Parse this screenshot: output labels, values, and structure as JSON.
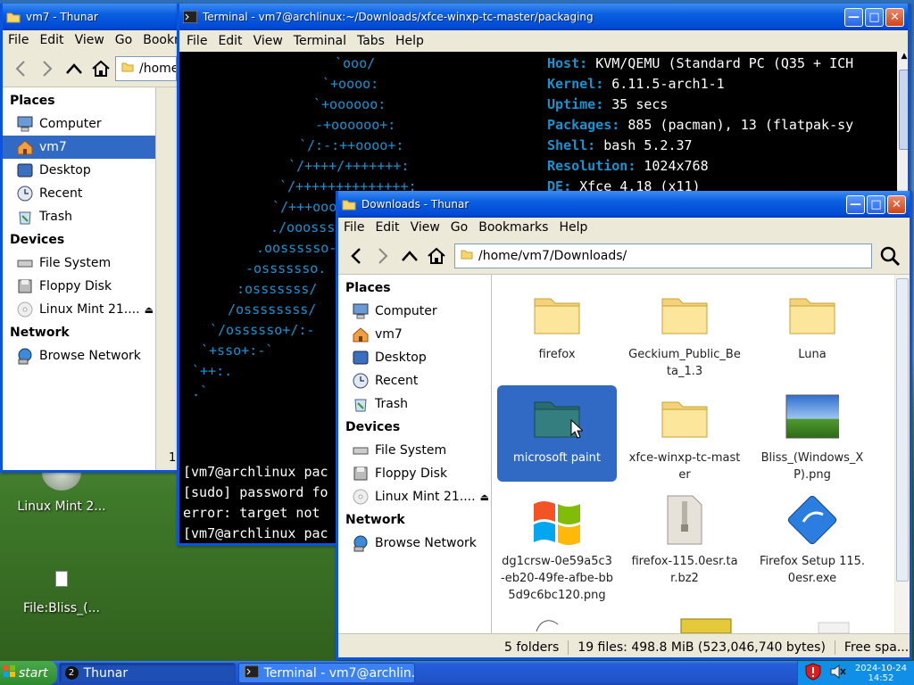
{
  "desktop": {
    "icons": [
      {
        "label": "Linux Mint 2..."
      },
      {
        "label": "File:Bliss_(..."
      }
    ]
  },
  "thunar_back": {
    "title": "vm7 - Thunar",
    "menu": [
      "File",
      "Edit",
      "View",
      "Go",
      "Bookm"
    ],
    "address": "/home",
    "places_header": "Places",
    "places": [
      "Computer",
      "vm7",
      "Desktop",
      "Recent",
      "Trash"
    ],
    "devices_header": "Devices",
    "devices": [
      "File System",
      "Floppy Disk",
      "Linux Mint 21...."
    ],
    "network_header": "Network",
    "network": [
      "Browse Network"
    ],
    "status_frag": "1"
  },
  "terminal": {
    "title": "Terminal - vm7@archlinux:~/Downloads/xfce-winxp-tc-master/packaging",
    "menu": [
      "File",
      "Edit",
      "View",
      "Terminal",
      "Tabs",
      "Help"
    ],
    "logo": [
      "`ooo/",
      "`+oooo:",
      "`+oooooo:",
      "-+oooooo+:",
      "`/:-:++oooo+:",
      "`/++++/+++++++:",
      "`/++++++++++++++:",
      "`/+++ooo",
      "./ooosss",
      ".oossssso-",
      "-osssssso.",
      ":osssssss/",
      "/ossssssss/",
      "`/ossssso+/:-",
      "`+sso+:-`",
      "`++:.",
      ".`"
    ],
    "info": [
      {
        "key": "Host",
        "val": "KVM/QEMU (Standard PC (Q35 + ICH"
      },
      {
        "key": "Kernel",
        "val": "6.11.5-arch1-1"
      },
      {
        "key": "Uptime",
        "val": "35 secs"
      },
      {
        "key": "Packages",
        "val": "885 (pacman), 13 (flatpak-sy"
      },
      {
        "key": "Shell",
        "val": "bash 5.2.37"
      },
      {
        "key": "Resolution",
        "val": "1024x768"
      },
      {
        "key": "DE",
        "val": "Xfce 4.18 (x11)"
      }
    ],
    "bottom": [
      "[vm7@archlinux pac",
      "[sudo] password fo",
      "error: target not",
      "[vm7@archlinux pac"
    ]
  },
  "thunar_front": {
    "title": "Downloads - Thunar",
    "menu": [
      "File",
      "Edit",
      "View",
      "Go",
      "Bookmarks",
      "Help"
    ],
    "address": "/home/vm7/Downloads/",
    "places_header": "Places",
    "places": [
      "Computer",
      "vm7",
      "Desktop",
      "Recent",
      "Trash"
    ],
    "devices_header": "Devices",
    "devices": [
      "File System",
      "Floppy Disk",
      "Linux Mint 21...."
    ],
    "network_header": "Network",
    "network": [
      "Browse Network"
    ],
    "files": [
      {
        "name": "firefox",
        "kind": "folder"
      },
      {
        "name": "Geckium_Public_Beta_1.3",
        "kind": "folder"
      },
      {
        "name": "Luna",
        "kind": "folder"
      },
      {
        "name": "microsoft paint",
        "kind": "folder-selected"
      },
      {
        "name": "xfce-winxp-tc-master",
        "kind": "folder"
      },
      {
        "name": "Bliss_(Windows_XP).png",
        "kind": "image"
      },
      {
        "name": "dg1crsw-0e59a5c3-eb20-49fe-afbe-bb5d9c6bc120.png",
        "kind": "winlogo"
      },
      {
        "name": "firefox-115.0esr.tar.bz2",
        "kind": "archive"
      },
      {
        "name": "Firefox Setup 115.0esr.exe",
        "kind": "exe"
      }
    ],
    "status": {
      "folders": "5 folders",
      "files": "19 files: 498.8 MiB (523,046,740 bytes)",
      "free": "Free spa..."
    }
  },
  "taskbar": {
    "start": "start",
    "badge": "2",
    "tasks": [
      "Thunar",
      "Terminal - vm7@archlin..."
    ],
    "date": "2024-10-24",
    "time": "14:52"
  },
  "colors": {
    "xp_blue": "#0a54de",
    "selection": "#316ac5",
    "arch_blue": "#1793d1"
  }
}
